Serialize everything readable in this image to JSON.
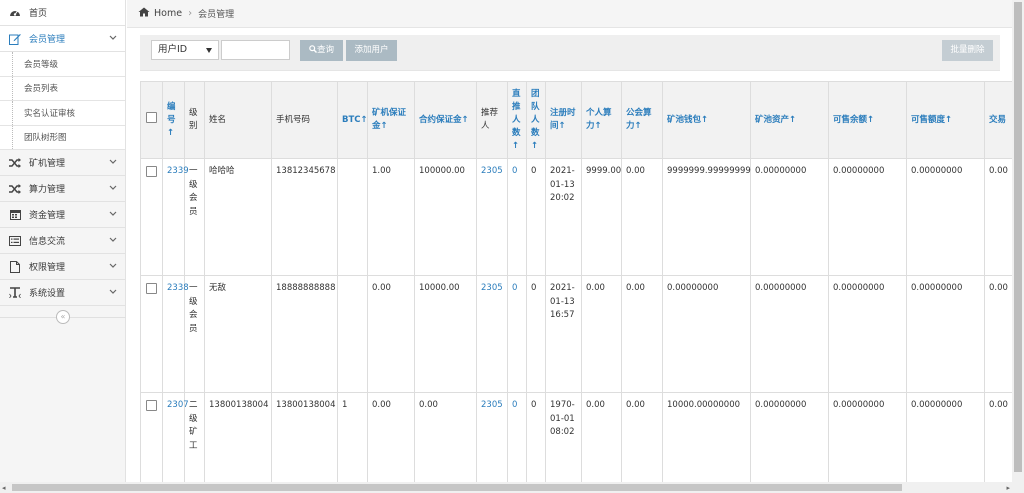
{
  "sidebar": {
    "items": [
      {
        "label": "首页",
        "icon": "dashboard-icon"
      },
      {
        "label": "会员管理",
        "icon": "edit-icon",
        "sub": [
          "会员等级",
          "会员列表",
          "实名认证审核",
          "团队树形图"
        ]
      },
      {
        "label": "矿机管理",
        "icon": "shuffle-icon"
      },
      {
        "label": "算力管理",
        "icon": "shuffle-icon"
      },
      {
        "label": "资金管理",
        "icon": "calendar-icon"
      },
      {
        "label": "信息交流",
        "icon": "list-icon"
      },
      {
        "label": "权限管理",
        "icon": "file-icon"
      },
      {
        "label": "系统设置",
        "icon": "text-icon"
      }
    ]
  },
  "breadcrumb": {
    "home": "Home",
    "current": "会员管理"
  },
  "toolbar": {
    "select_value": "用户ID",
    "search_label": "查询",
    "add_label": "添加用户",
    "batch_delete_label": "批量删除"
  },
  "table": {
    "headers": [
      "编号↑",
      "级别",
      "姓名",
      "手机号码",
      "BTC↑",
      "矿机保证金↑",
      "合约保证金↑",
      "推荐人",
      "直推人数↑",
      "团队人数↑",
      "注册时间↑",
      "个人算力↑",
      "公会算力↑",
      "矿池钱包↑",
      "矿池资产↑",
      "可售余额↑",
      "可售额度↑",
      "交易"
    ],
    "rows": [
      {
        "id": "2339",
        "level": "一级会员",
        "name": "哈哈哈",
        "phone": "13812345678",
        "btc": "",
        "miner_deposit": "1.00",
        "contract_deposit": "100000.00",
        "referrer": "2305",
        "direct": "0",
        "team": "0",
        "reg_time": "2021-01-13 20:02",
        "personal_power": "9999.00",
        "guild_power": "0.00",
        "pool_wallet": "9999999.99999999",
        "pool_assets": "0.00000000",
        "sellable_balance": "0.00000000",
        "sellable_quota": "0.00000000",
        "trade": "0.00"
      },
      {
        "id": "2338",
        "level": "一级会员",
        "name": "无敌",
        "phone": "18888888888",
        "btc": "",
        "miner_deposit": "0.00",
        "contract_deposit": "10000.00",
        "referrer": "2305",
        "direct": "0",
        "team": "0",
        "reg_time": "2021-01-13 16:57",
        "personal_power": "0.00",
        "guild_power": "0.00",
        "pool_wallet": "0.00000000",
        "pool_assets": "0.00000000",
        "sellable_balance": "0.00000000",
        "sellable_quota": "0.00000000",
        "trade": "0.00"
      },
      {
        "id": "2307",
        "level": "二级矿工",
        "name": "13800138004",
        "phone": "13800138004",
        "btc": "1",
        "miner_deposit": "0.00",
        "contract_deposit": "0.00",
        "referrer": "2305",
        "direct": "0",
        "team": "0",
        "reg_time": "1970-01-01 08:02",
        "personal_power": "0.00",
        "guild_power": "0.00",
        "pool_wallet": "10000.00000000",
        "pool_assets": "0.00000000",
        "sellable_balance": "0.00000000",
        "sellable_quota": "0.00000000",
        "trade": "0.00"
      }
    ]
  },
  "colors": {
    "accent": "#2b7dbc",
    "button": "#abbac3"
  }
}
